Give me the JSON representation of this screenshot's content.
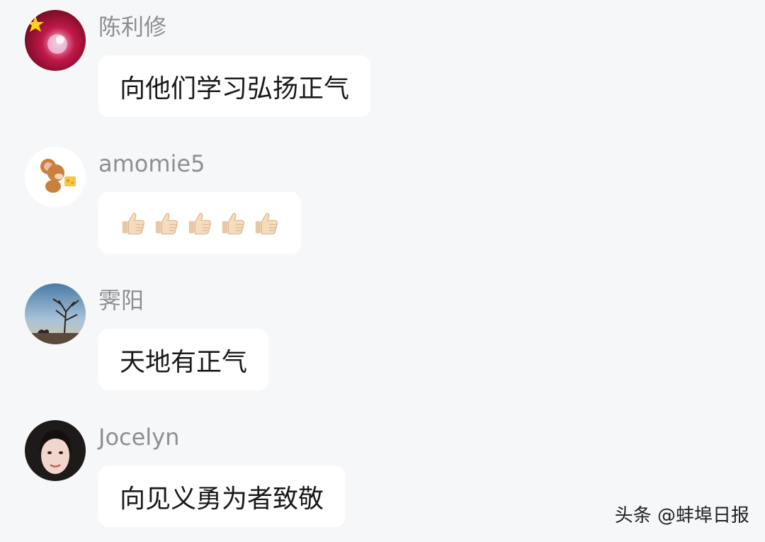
{
  "comments": [
    {
      "username": "陈利修",
      "text": "向他们学习弘扬正气",
      "avatar": "red-flag-star-avatar"
    },
    {
      "username": "amomie5",
      "text": "👍👍👍👍👍",
      "avatar": "cartoon-mouse-avatar",
      "emoji": "thumbs-up-icon",
      "emoji_count": 5
    },
    {
      "username": "霁阳",
      "text": "天地有正气",
      "avatar": "tree-sky-avatar"
    },
    {
      "username": "Jocelyn",
      "text": "向见义勇为者致敬",
      "avatar": "woman-portrait-avatar"
    }
  ],
  "watermark": "头条 @蚌埠日报",
  "colors": {
    "background": "#f6f7f9",
    "bubble": "#ffffff",
    "username": "#8e8e93",
    "text": "#1a1a1a"
  }
}
